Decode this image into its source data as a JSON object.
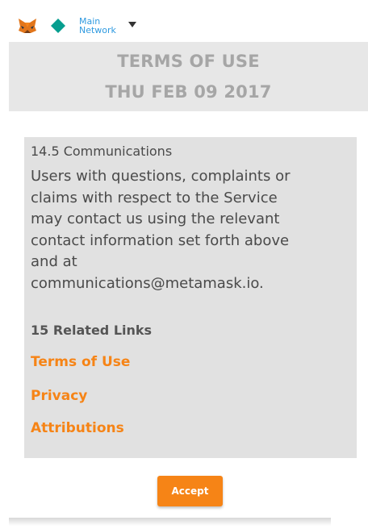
{
  "topbar": {
    "network_line1": "Main",
    "network_line2": "Network",
    "icons": {
      "logo": "metamask-fox-icon",
      "network": "network-diamond-icon",
      "dropdown": "caret-down-icon"
    },
    "colors": {
      "network_text": "#2f9ae0",
      "network_diamond": "#069e8f"
    }
  },
  "header": {
    "title": "TERMS OF USE",
    "date": "THU FEB 09 2017"
  },
  "content": {
    "section_heading": "14.5 Communications",
    "body_lines": [
      "Users with questions, complaints or",
      "claims with respect to the Service",
      "may contact us using the relevant",
      "contact information set forth above",
      "and at",
      "communications@metamask.io."
    ],
    "related_heading": "15 Related Links",
    "links": [
      "Terms of Use",
      "Privacy",
      "Attributions"
    ]
  },
  "actions": {
    "accept_label": "Accept"
  },
  "theme": {
    "accent": "#f68416",
    "header_bg": "#e7e7e7",
    "panel_bg": "#e1e1e1"
  }
}
